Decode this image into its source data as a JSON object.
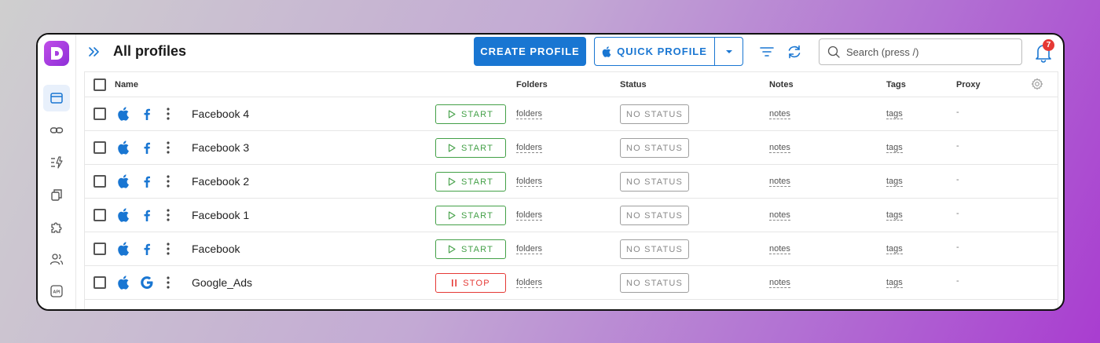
{
  "header": {
    "title": "All profiles",
    "create_label": "CREATE PROFILE",
    "quick_label": "QUICK PROFILE",
    "search_placeholder": "Search (press /)",
    "notification_count": "7"
  },
  "sidebar": {
    "items": [
      {
        "name": "browser-profiles",
        "active": true
      },
      {
        "name": "proxies",
        "active": false
      },
      {
        "name": "automation",
        "active": false
      },
      {
        "name": "copy",
        "active": false
      },
      {
        "name": "extensions",
        "active": false
      },
      {
        "name": "team",
        "active": false
      },
      {
        "name": "api",
        "active": false
      }
    ],
    "api_label": "API"
  },
  "table": {
    "columns": {
      "name": "Name",
      "folders": "Folders",
      "status": "Status",
      "notes": "Notes",
      "tags": "Tags",
      "proxy": "Proxy"
    },
    "rows": [
      {
        "name": "Facebook 4",
        "os": "apple",
        "site": "facebook",
        "action": "START",
        "action_type": "start",
        "folders": "folders",
        "status": "NO STATUS",
        "notes": "notes",
        "tags": "tags",
        "proxy": "-"
      },
      {
        "name": "Facebook 3",
        "os": "apple",
        "site": "facebook",
        "action": "START",
        "action_type": "start",
        "folders": "folders",
        "status": "NO STATUS",
        "notes": "notes",
        "tags": "tags",
        "proxy": "-"
      },
      {
        "name": "Facebook 2",
        "os": "apple",
        "site": "facebook",
        "action": "START",
        "action_type": "start",
        "folders": "folders",
        "status": "NO STATUS",
        "notes": "notes",
        "tags": "tags",
        "proxy": "-"
      },
      {
        "name": "Facebook 1",
        "os": "apple",
        "site": "facebook",
        "action": "START",
        "action_type": "start",
        "folders": "folders",
        "status": "NO STATUS",
        "notes": "notes",
        "tags": "tags",
        "proxy": "-"
      },
      {
        "name": "Facebook",
        "os": "apple",
        "site": "facebook",
        "action": "START",
        "action_type": "start",
        "folders": "folders",
        "status": "NO STATUS",
        "notes": "notes",
        "tags": "tags",
        "proxy": "-"
      },
      {
        "name": "Google_Ads",
        "os": "apple",
        "site": "google",
        "action": "STOP",
        "action_type": "stop",
        "folders": "folders",
        "status": "NO STATUS",
        "notes": "notes",
        "tags": "tags",
        "proxy": "-"
      }
    ]
  },
  "colors": {
    "primary": "#1976d2",
    "start": "#43a047",
    "stop": "#e53935",
    "logo": "#a43ee0"
  }
}
